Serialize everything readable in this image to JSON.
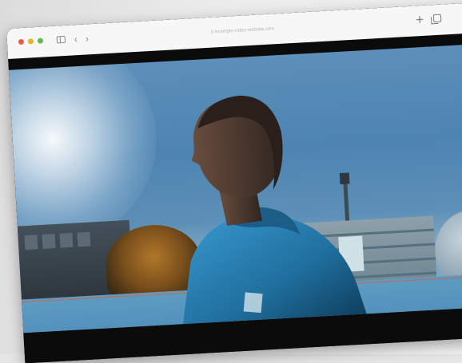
{
  "browser": {
    "address_text": "tr.example-video-website.com",
    "traffic_light_colors": {
      "close": "#ec5a52",
      "minimize": "#e6b233",
      "zoom": "#5ebc4a"
    },
    "icons": {
      "back": "‹",
      "forward": "›",
      "new_tab": "+"
    }
  },
  "video": {
    "subject": "person-in-blue-jacket",
    "accent_color": "#2e8cc0"
  }
}
